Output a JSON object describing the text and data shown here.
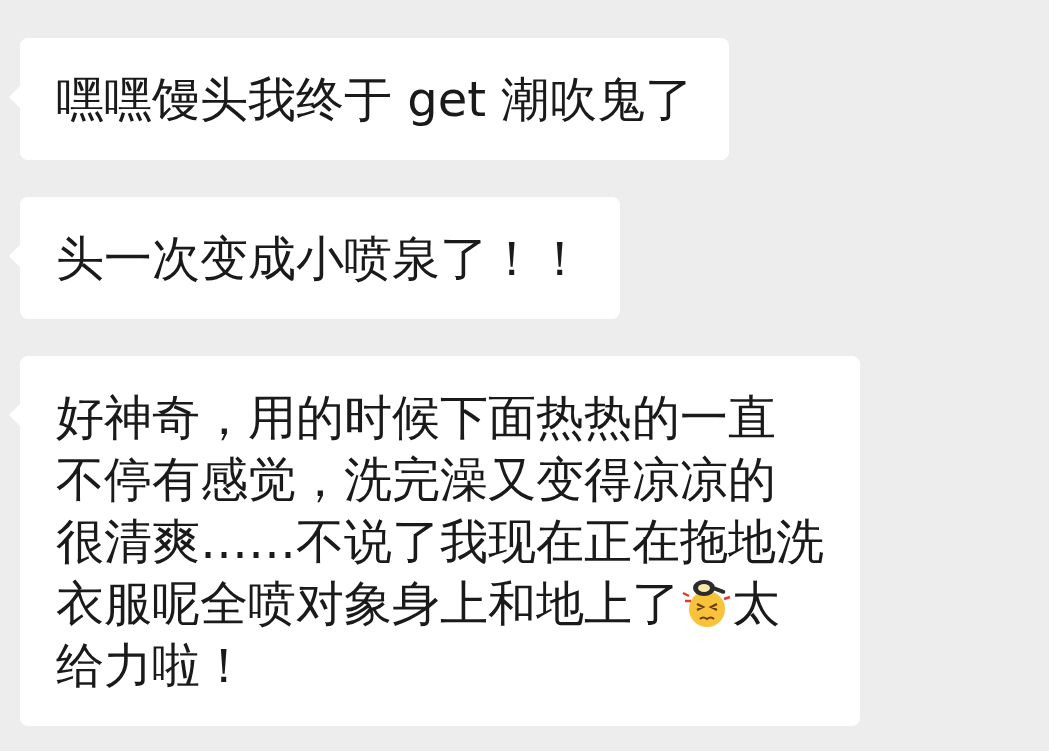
{
  "messages": [
    {
      "lines": [
        [
          {
            "kind": "text",
            "text": "嘿嘿馒头我终于 get 潮吹鬼了"
          }
        ]
      ]
    },
    {
      "lines": [
        [
          {
            "kind": "text",
            "text": "头一次变成小喷泉了！！"
          }
        ]
      ]
    },
    {
      "lines": [
        [
          {
            "kind": "text",
            "text": "好神奇，用的时候下面热热的一直"
          }
        ],
        [
          {
            "kind": "text",
            "text": "不停有感觉，洗完澡又变得凉凉的"
          }
        ],
        [
          {
            "kind": "text",
            "text": "很清爽……不说了我现在正在拖地洗"
          }
        ],
        [
          {
            "kind": "text",
            "text": "衣服呢全喷对象身上和地上了"
          },
          {
            "kind": "emoji"
          },
          {
            "kind": "text",
            "text": "太"
          }
        ],
        [
          {
            "kind": "text",
            "text": "给力啦！"
          }
        ]
      ]
    }
  ]
}
